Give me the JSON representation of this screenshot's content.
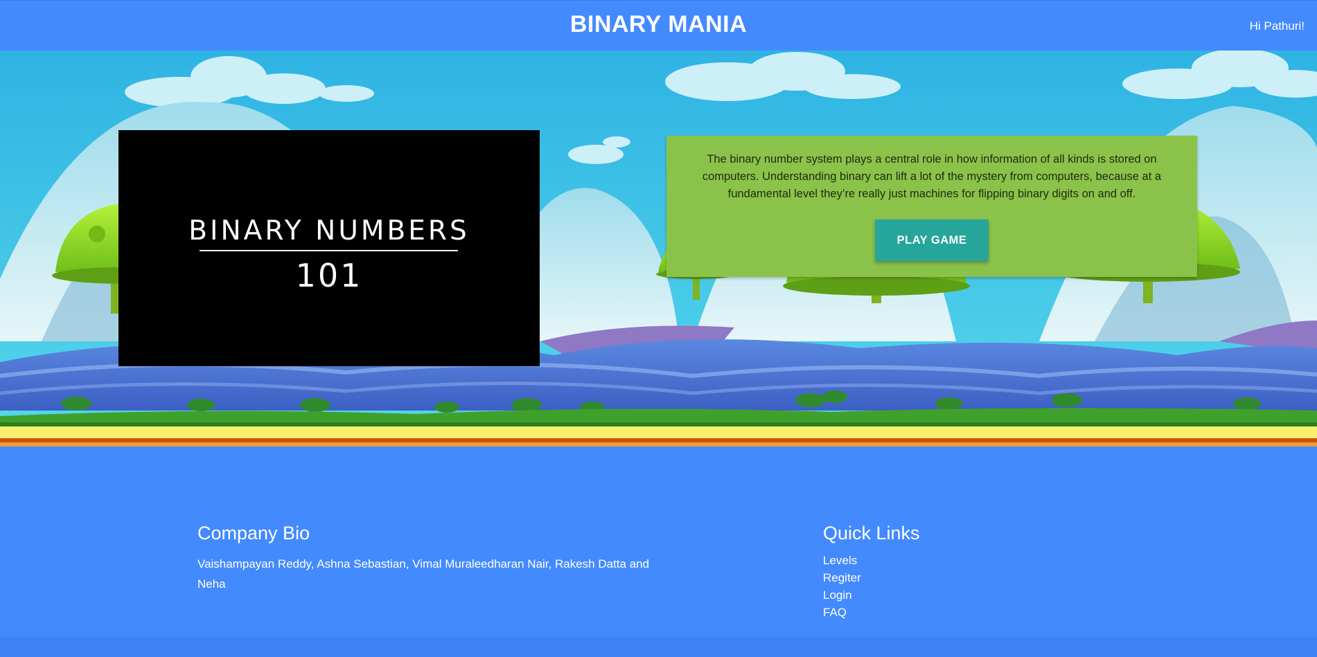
{
  "header": {
    "title": "BINARY MANIA",
    "greeting": "Hi Pathuri!"
  },
  "hero": {
    "video": {
      "title": "BINARY NUMBERS",
      "number": "101"
    },
    "info": {
      "text": "The binary number system plays a central role in how information of all kinds is stored on computers. Understanding binary can lift a lot of the mystery from computers, because at a fundamental level they’re really just machines for flipping binary digits on and off.",
      "button_label": "PLAY GAME"
    }
  },
  "footer": {
    "bio": {
      "heading": "Company Bio",
      "text": "Vaishampayan Reddy, Ashna Sebastian, Vimal Muraleedharan Nair, Rakesh Datta and Neha"
    },
    "links": {
      "heading": "Quick Links",
      "items": [
        {
          "label": "Levels"
        },
        {
          "label": "Regiter"
        },
        {
          "label": "Login"
        },
        {
          "label": "FAQ"
        }
      ]
    }
  },
  "colors": {
    "primary": "#448aff",
    "card": "#8bc34a",
    "button": "#26a69a"
  }
}
